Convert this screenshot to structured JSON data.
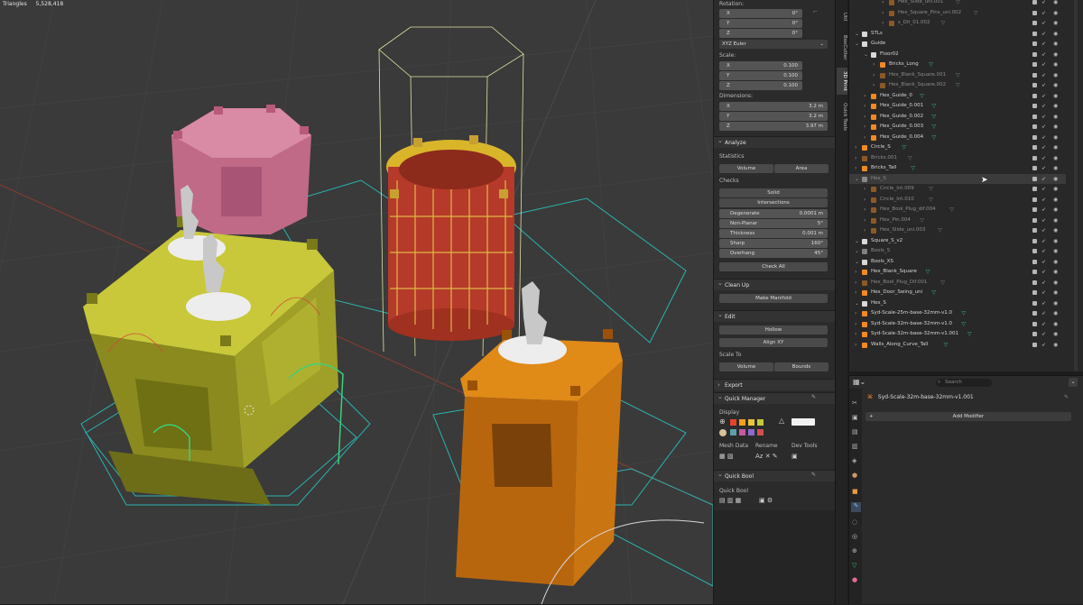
{
  "viewport": {
    "stat_label": "Triangles",
    "stat_value": "5,528,418"
  },
  "transform": {
    "rotation_label": "Rotation:",
    "rotation": [
      {
        "axis": "X",
        "value": "0°"
      },
      {
        "axis": "Y",
        "value": "0°"
      },
      {
        "axis": "Z",
        "value": "0°"
      }
    ],
    "rotation_mode": "XYZ Euler",
    "scale_label": "Scale:",
    "scale": [
      {
        "axis": "X",
        "value": "0.100"
      },
      {
        "axis": "Y",
        "value": "0.100"
      },
      {
        "axis": "Z",
        "value": "0.100"
      }
    ],
    "dimensions_label": "Dimensions:",
    "dimensions": [
      {
        "axis": "X",
        "value": "3.2 m"
      },
      {
        "axis": "Y",
        "value": "3.2 m"
      },
      {
        "axis": "Z",
        "value": "3.97 m"
      }
    ]
  },
  "analyze": {
    "header": "Analyze",
    "statistics_label": "Statistics",
    "volume_btn": "Volume",
    "area_btn": "Area",
    "checks_label": "Checks",
    "solid_btn": "Solid",
    "intersections_btn": "Intersections",
    "checks": [
      {
        "label": "Degenerate",
        "value": "0.0001 m"
      },
      {
        "label": "Non-Planar",
        "value": "5°"
      },
      {
        "label": "Thickness",
        "value": "0.001 m"
      },
      {
        "label": "Sharp",
        "value": "160°"
      },
      {
        "label": "Overhang",
        "value": "45°"
      }
    ],
    "check_all_btn": "Check All"
  },
  "cleanup": {
    "header": "Clean Up",
    "make_manifold_btn": "Make Manifold"
  },
  "edit": {
    "header": "Edit",
    "hollow_btn": "Hollow",
    "align_btn": "Align XY",
    "scale_to_label": "Scale To",
    "volume_btn": "Volume",
    "bounds_btn": "Bounds"
  },
  "export": {
    "header": "Export"
  },
  "quick_manager": {
    "header": "Quick Manager",
    "display_label": "Display",
    "mesh_data_label": "Mesh Data",
    "rename_label": "Rename",
    "dev_tools_label": "Dev Tools",
    "swatches": [
      "#e4452a",
      "#f0a020",
      "#e8c53a",
      "#bfcb3a",
      "#5aa0a8",
      "#c45aa0",
      "#8c6ad0",
      "#d05050"
    ]
  },
  "quick_bool": {
    "header": "Quick Bool",
    "label": "Quick Bool"
  },
  "tabs": [
    "Util",
    "BoxCutter",
    "3D Print",
    "Quick Tools"
  ],
  "outliner": {
    "rows": [
      {
        "name": "Hex_Slide_uni.001",
        "indent": 3,
        "type": "mesh",
        "dim": true
      },
      {
        "name": "Hex_Square_Pins_uni.002",
        "indent": 3,
        "type": "mesh",
        "dim": true
      },
      {
        "name": "s_Dit_01.002",
        "indent": 3,
        "type": "mesh",
        "dim": true
      },
      {
        "name": "STLs",
        "indent": 0,
        "type": "collection",
        "dim": false
      },
      {
        "name": "Guide",
        "indent": 0,
        "type": "collection",
        "dim": false
      },
      {
        "name": "Floor02",
        "indent": 1,
        "type": "collection",
        "dim": false
      },
      {
        "name": "Bricks_Long",
        "indent": 2,
        "type": "mesh",
        "dim": false
      },
      {
        "name": "Hex_Blank_Square.001",
        "indent": 2,
        "type": "mesh",
        "dim": true
      },
      {
        "name": "Hex_Blank_Square.002",
        "indent": 2,
        "type": "mesh",
        "dim": true
      },
      {
        "name": "Hex_Guide_0",
        "indent": 1,
        "type": "mesh",
        "dim": false
      },
      {
        "name": "Hex_Guide_0.001",
        "indent": 1,
        "type": "mesh",
        "dim": false
      },
      {
        "name": "Hex_Guide_0.002",
        "indent": 1,
        "type": "mesh",
        "dim": false
      },
      {
        "name": "Hex_Guide_0.003",
        "indent": 1,
        "type": "mesh",
        "dim": false
      },
      {
        "name": "Hex_Guide_0.004",
        "indent": 1,
        "type": "mesh",
        "dim": false
      },
      {
        "name": "Circle_S",
        "indent": 0,
        "type": "mesh",
        "dim": false
      },
      {
        "name": "Bricks.001",
        "indent": 0,
        "type": "mesh",
        "dim": true
      },
      {
        "name": "Bricks_Tall",
        "indent": 0,
        "type": "mesh",
        "dim": false
      },
      {
        "name": "Hex_S",
        "indent": 0,
        "type": "collection",
        "dim": true
      },
      {
        "name": "Circle_Int.009",
        "indent": 1,
        "type": "mesh",
        "dim": true
      },
      {
        "name": "Circle_Int.010",
        "indent": 1,
        "type": "mesh",
        "dim": true
      },
      {
        "name": "Hex_Bool_Plug_dif.004",
        "indent": 1,
        "type": "mesh",
        "dim": true
      },
      {
        "name": "Hex_Pin.004",
        "indent": 1,
        "type": "mesh",
        "dim": true
      },
      {
        "name": "Hex_Slide_uni.003",
        "indent": 1,
        "type": "mesh",
        "dim": true
      },
      {
        "name": "Square_S_v2",
        "indent": 0,
        "type": "collection",
        "dim": false
      },
      {
        "name": "Bools_S",
        "indent": 0,
        "type": "collection",
        "dim": true
      },
      {
        "name": "Bools_XS",
        "indent": 0,
        "type": "collection",
        "dim": false
      },
      {
        "name": "Hex_Blank_Square",
        "indent": 0,
        "type": "mesh",
        "dim": false
      },
      {
        "name": "Hex_Bool_Plug_Dif.001",
        "indent": 0,
        "type": "mesh",
        "dim": true
      },
      {
        "name": "Hex_Door_Swing_uni",
        "indent": 0,
        "type": "mesh",
        "dim": false
      },
      {
        "name": "Hex_S",
        "indent": 0,
        "type": "collection",
        "dim": false
      },
      {
        "name": "Syd-Scale-25m-base-32mm-v1.0",
        "indent": 0,
        "type": "mesh",
        "dim": false
      },
      {
        "name": "Syd-Scale-32m-base-32mm-v1.0",
        "indent": 0,
        "type": "mesh",
        "dim": false
      },
      {
        "name": "Syd-Scale-32m-base-32mm-v1.001",
        "indent": 0,
        "type": "mesh",
        "dim": false
      },
      {
        "name": "Walls_Along_Curve_Tall",
        "indent": 0,
        "type": "mesh",
        "dim": false
      }
    ]
  },
  "properties": {
    "search_placeholder": "Search",
    "object_name": "Syd-Scale-32m-base-32mm-v1.001",
    "add_modifier": "Add Modifier"
  }
}
